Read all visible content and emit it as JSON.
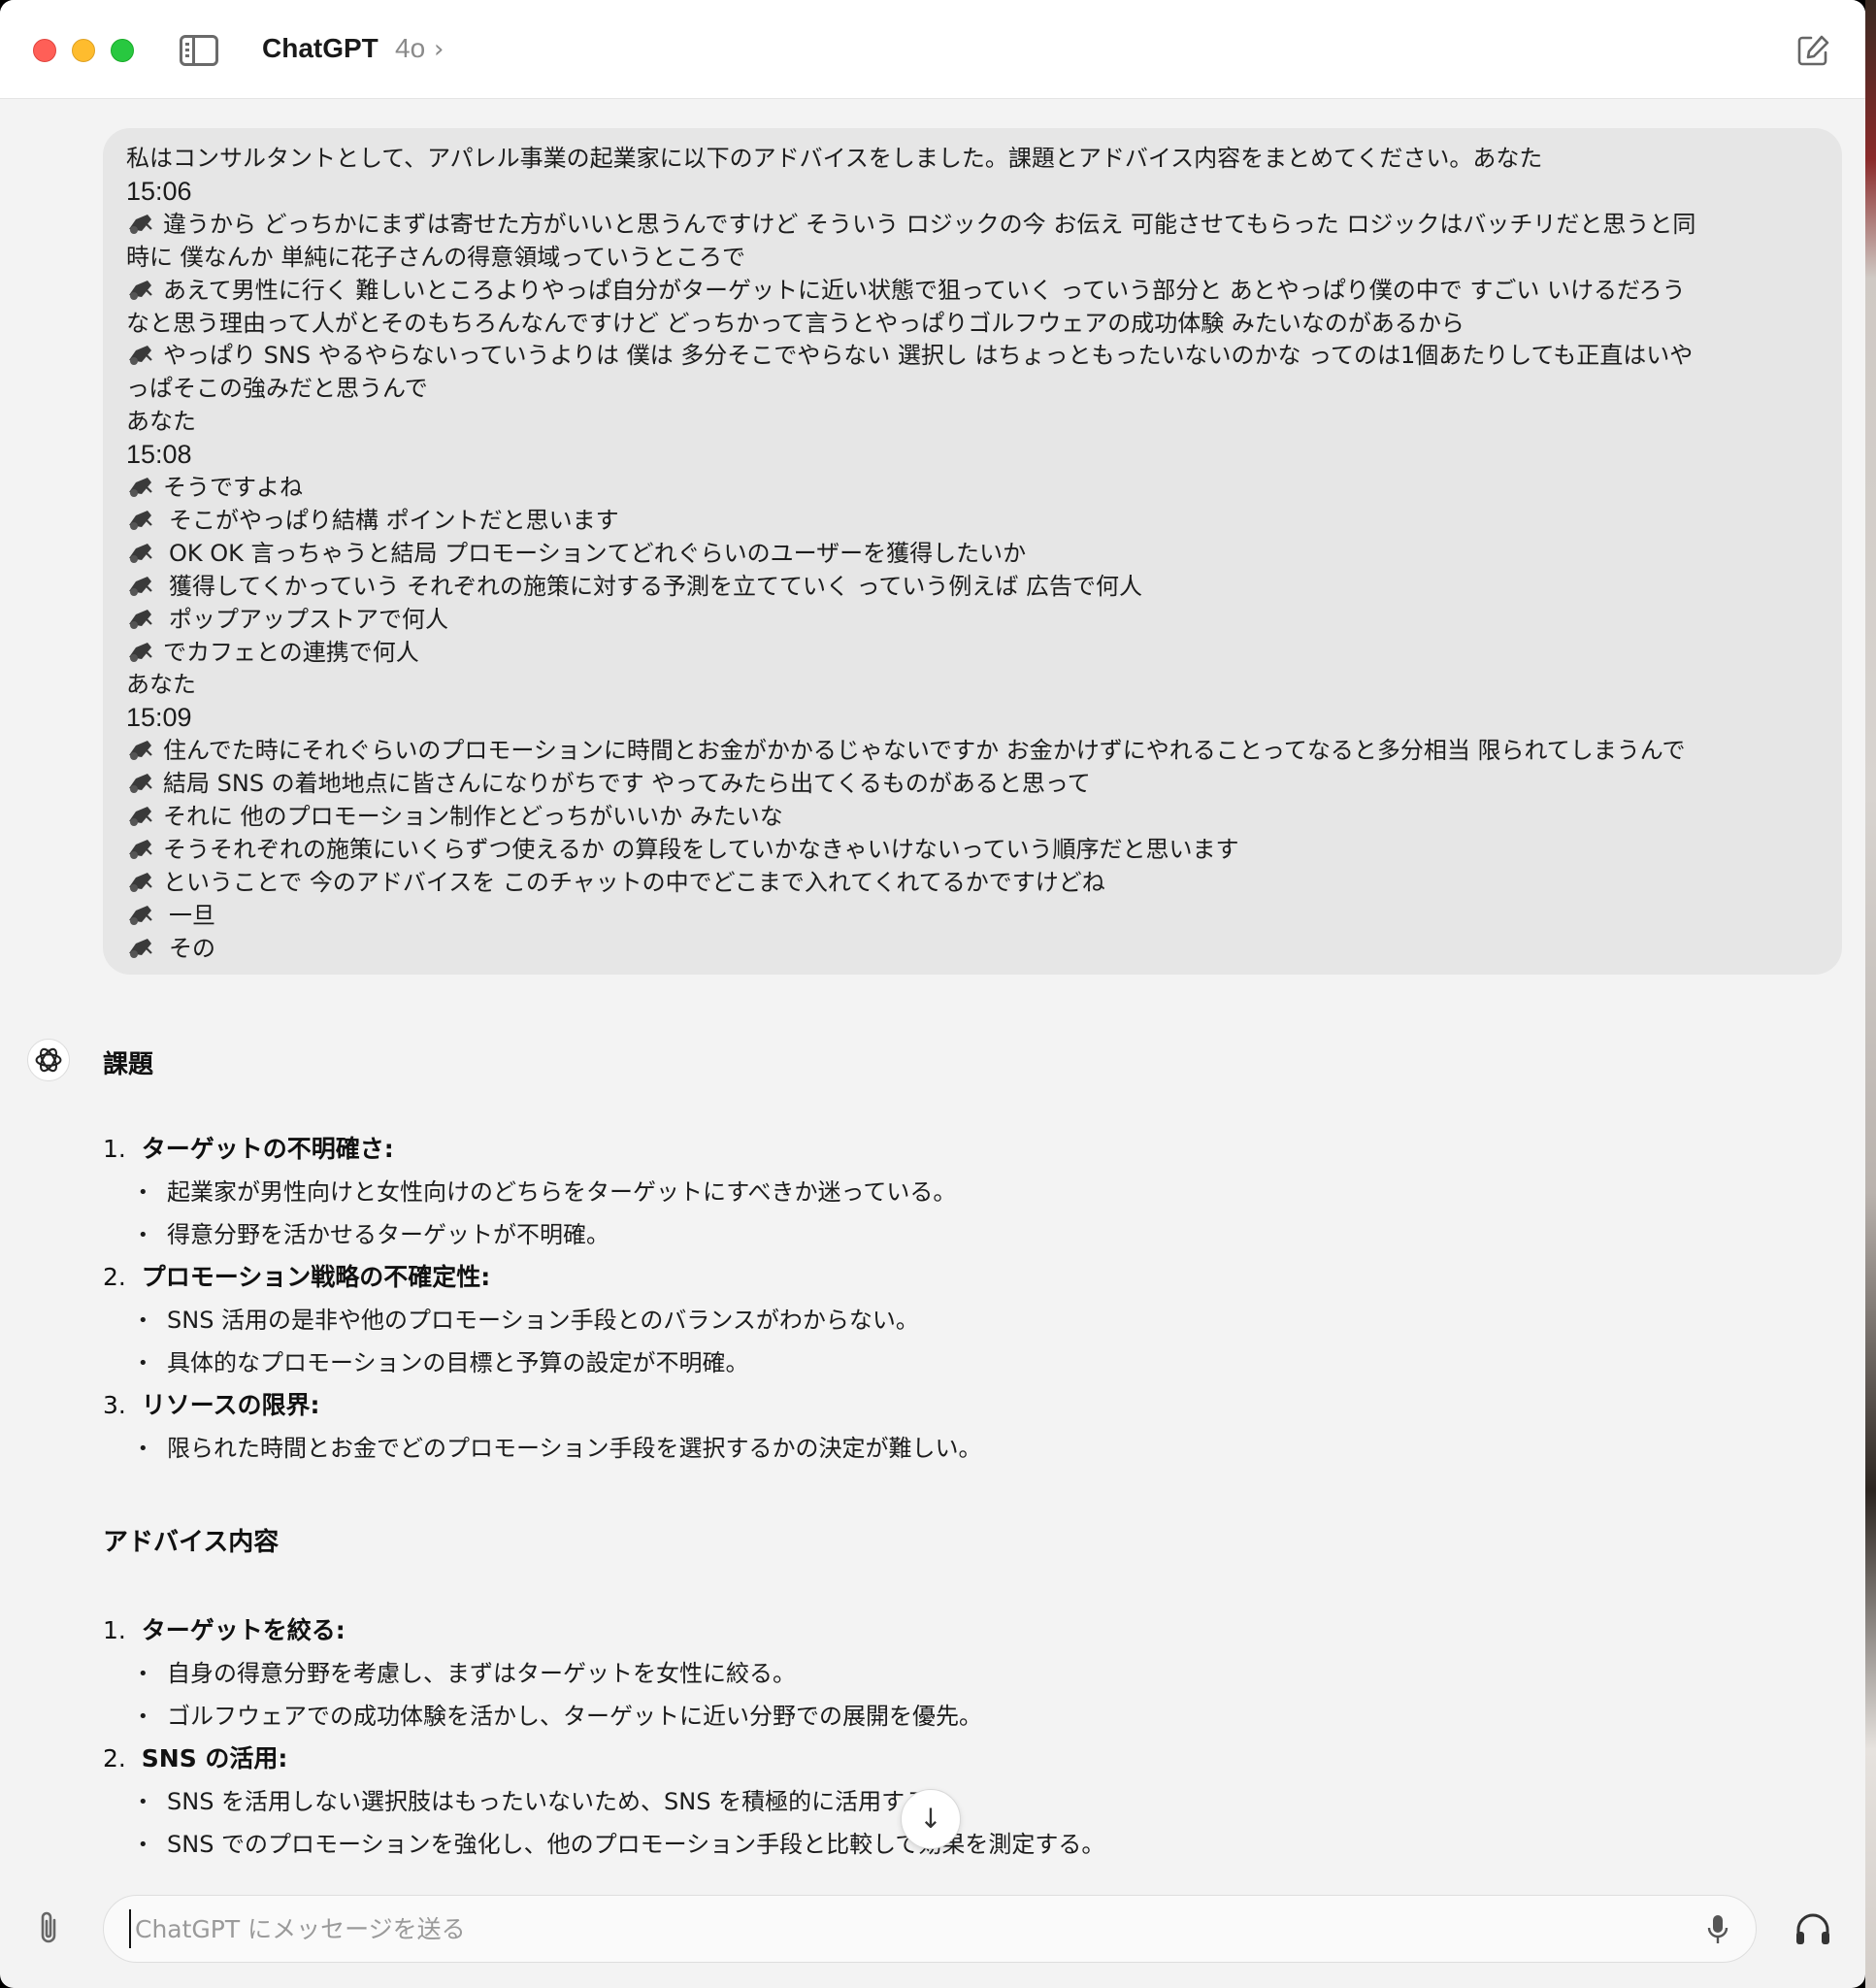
{
  "titlebar": {
    "app_title": "ChatGPT",
    "model": "4o",
    "chevron": "›",
    "icons": [
      "sidebar-toggle-icon",
      "new-chat-icon"
    ]
  },
  "user_message": {
    "lines": [
      "私はコンサルタントとして、アパレル事業の起業家に以下のアドバイスをしました。課題とアドバイス内容をまとめてください。あなた",
      "15:06",
      "違うから どっちかにまずは寄せた方がいいと思うんですけど そういう ロジックの今 お伝え 可能させてもらった ロジックはバッチリだと思うと同",
      "時に 僕なんか 単純に花子さんの得意領域っていうところで",
      "あえて男性に行く 難しいところよりやっぱ自分がターゲットに近い状態で狙っていく っていう部分と あとやっぱり僕の中で すごい いけるだろう",
      "なと思う理由って人がとそのもちろんなんですけど どっちかって言うとやっぱりゴルフウェアの成功体験 みたいなのがあるから",
      "やっぱり SNS やるやらないっていうよりは 僕は 多分そこでやらない 選択し はちょっともったいないのかな ってのは1個あたりしても正直はいや",
      "っぱそこの強みだと思うんで",
      "あなた",
      "15:08",
      "そうですよね",
      "そこがやっぱり結構 ポイントだと思います",
      "OK OK 言っちゃうと結局 プロモーションてどれぐらいのユーザーを獲得したいか",
      "獲得してくかっていう それぞれの施策に対する予測を立てていく っていう例えば 広告で何人",
      "ポップアップストアで何人",
      "でカフェとの連携で何人",
      "あなた",
      "15:09",
      "住んでた時にそれぐらいのプロモーションに時間とお金がかかるじゃないですか お金かけずにやれることってなると多分相当 限られてしまうんで",
      "結局 SNS の着地地点に皆さんになりがちです やってみたら出てくるものがあると思って",
      "それに 他のプロモーション制作とどっちがいいか みたいな",
      "そうそれぞれの施策にいくらずつ使えるか の算段をしていかなきゃいけないっていう順序だと思います",
      "ということで 今のアドバイスを このチャットの中でどこまで入れてくれてるかですけどね",
      "一旦",
      "その"
    ],
    "speaker_icon": "speaker-icon"
  },
  "assistant": {
    "avatar_icon": "openai-logo-icon",
    "section1_title": "課題",
    "section1_items": [
      {
        "num": "1.",
        "title": "ターゲットの不明確さ:",
        "bullets": [
          "起業家が男性向けと女性向けのどちらをターゲットにすべきか迷っている。",
          "得意分野を活かせるターゲットが不明確。"
        ]
      },
      {
        "num": "2.",
        "title": "プロモーション戦略の不確定性:",
        "bullets": [
          "SNS 活用の是非や他のプロモーション手段とのバランスがわからない。",
          "具体的なプロモーションの目標と予算の設定が不明確。"
        ]
      },
      {
        "num": "3.",
        "title": "リソースの限界:",
        "bullets": [
          "限られた時間とお金でどのプロモーション手段を選択するかの決定が難しい。"
        ]
      }
    ],
    "section2_title": "アドバイス内容",
    "section2_items": [
      {
        "num": "1.",
        "title": "ターゲットを絞る:",
        "bullets": [
          "自身の得意分野を考慮し、まずはターゲットを女性に絞る。",
          "ゴルフウェアでの成功体験を活かし、ターゲットに近い分野での展開を優先。"
        ]
      },
      {
        "num": "2.",
        "title": "SNS の活用:",
        "bullets": [
          "SNS を活用しない選択肢はもったいないため、SNS を積極的に活用する。",
          "SNS でのプロモーションを強化し、他のプロモーション手段と比較して効果を測定する。"
        ]
      }
    ],
    "bullet_char": "•"
  },
  "scroll_button": {
    "icon": "arrow-down-icon",
    "glyph": "↓"
  },
  "composer": {
    "placeholder": "ChatGPT にメッセージを送る",
    "value": "",
    "icons": [
      "paperclip-icon",
      "microphone-icon",
      "headphones-icon"
    ]
  },
  "colors": {
    "window_bg": "#f3f3f3",
    "bubble_bg": "#e6e6e6",
    "titlebar_bg": "#ffffff",
    "close": "#ff5f57",
    "minimize": "#febc2e",
    "zoom": "#28c840"
  }
}
